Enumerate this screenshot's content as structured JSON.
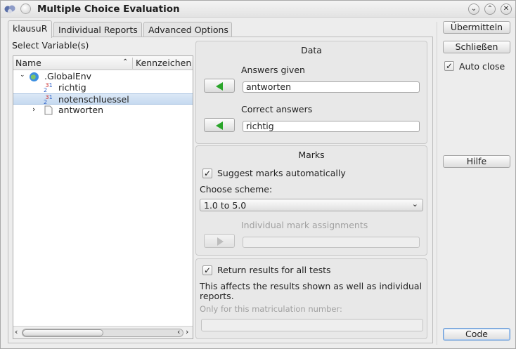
{
  "window": {
    "title": "Multiple Choice Evaluation"
  },
  "tabs": [
    {
      "label": "klausuR",
      "active": true
    },
    {
      "label": "Individual Reports",
      "active": false
    },
    {
      "label": "Advanced Options",
      "active": false
    }
  ],
  "variables": {
    "label": "Select Variable(s)",
    "columns": [
      "Name",
      "Kennzeichen"
    ],
    "rows": [
      {
        "name": ".GlobalEnv",
        "icon": "globe-icon"
      },
      {
        "name": "richtig",
        "icon": "numeric-vector-icon"
      },
      {
        "name": "notenschluessel",
        "icon": "numeric-vector-icon",
        "selected": true
      },
      {
        "name": "antworten",
        "icon": "data-frame-icon"
      }
    ]
  },
  "data_group": {
    "title": "Data",
    "answers_label": "Answers given",
    "answers_value": "antworten",
    "correct_label": "Correct answers",
    "correct_value": "richtig"
  },
  "marks_group": {
    "title": "Marks",
    "suggest_label": "Suggest marks automatically",
    "scheme_label": "Choose scheme:",
    "scheme_value": "1.0 to 5.0",
    "individual_label": "Individual mark assignments"
  },
  "results_group": {
    "return_all_label": "Return results for all tests",
    "info_line1": "This affects the results shown as well as individual",
    "info_line2": "reports.",
    "matric_label": "Only for this matriculation number:"
  },
  "buttons": {
    "submit": "Übermitteln",
    "close": "Schließen",
    "auto_close": "Auto close",
    "help": "Hilfe",
    "code": "Code"
  }
}
